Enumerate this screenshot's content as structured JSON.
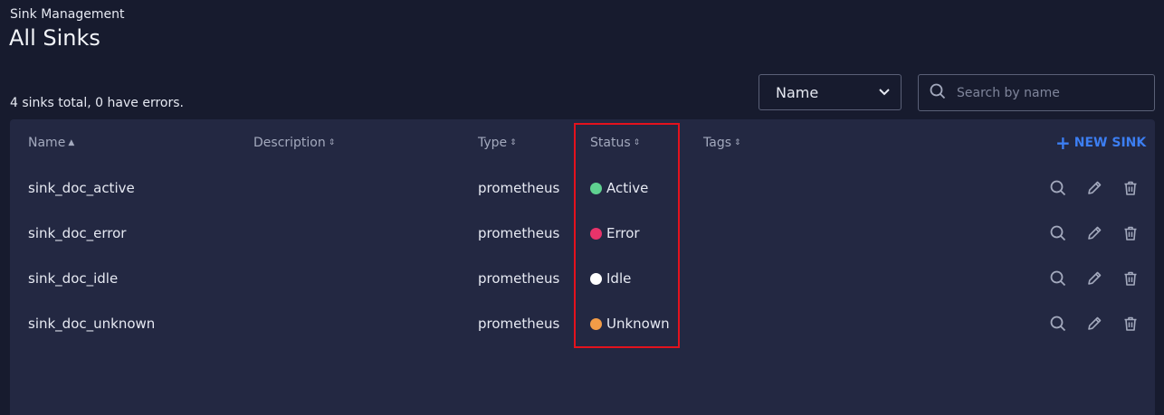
{
  "header": {
    "breadcrumb": "Sink Management",
    "title": "All Sinks"
  },
  "summary": "4 sinks total, 0 have errors.",
  "filter": {
    "selected": "Name"
  },
  "search": {
    "placeholder": "Search by name",
    "value": ""
  },
  "table": {
    "columns": {
      "name": "Name",
      "description": "Description",
      "type": "Type",
      "status": "Status",
      "tags": "Tags"
    },
    "new_button": "NEW SINK",
    "rows": [
      {
        "name": "sink_doc_active",
        "description": "",
        "type": "prometheus",
        "status": "Active",
        "status_color": "#5fd190",
        "tags": ""
      },
      {
        "name": "sink_doc_error",
        "description": "",
        "type": "prometheus",
        "status": "Error",
        "status_color": "#e8336a",
        "tags": ""
      },
      {
        "name": "sink_doc_idle",
        "description": "",
        "type": "prometheus",
        "status": "Idle",
        "status_color": "#ffffff",
        "tags": ""
      },
      {
        "name": "sink_doc_unknown",
        "description": "",
        "type": "prometheus",
        "status": "Unknown",
        "status_color": "#f39c47",
        "tags": ""
      }
    ]
  },
  "colors": {
    "background": "#171b2e",
    "card": "#232842",
    "accent": "#3c7ef2",
    "highlight": "#e3121d"
  },
  "icons": {
    "row_actions": [
      "search-icon",
      "edit-pencil-icon",
      "trash-icon"
    ]
  }
}
